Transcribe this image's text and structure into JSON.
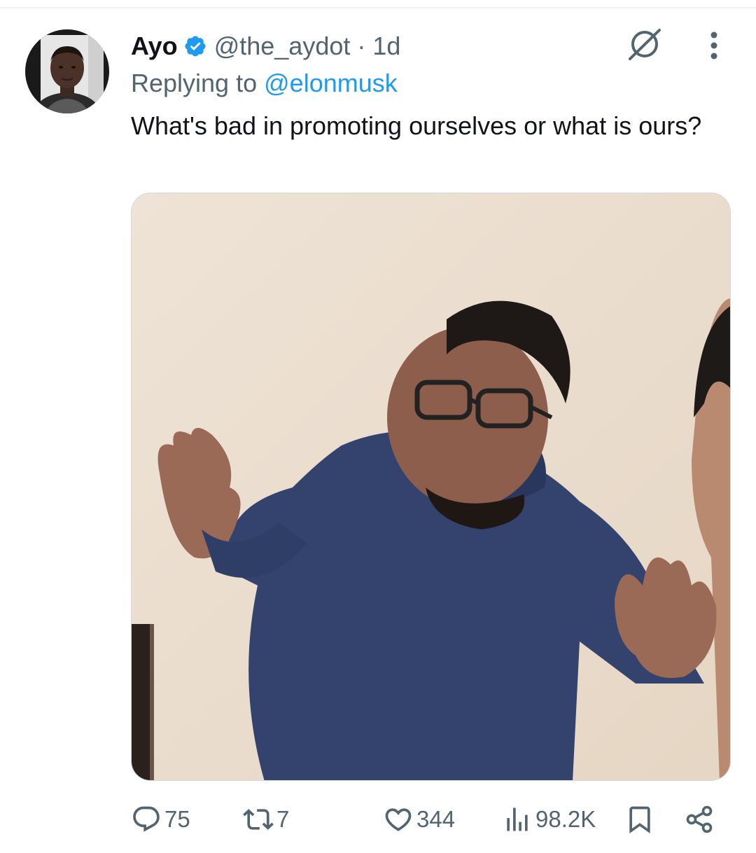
{
  "tweet": {
    "display_name": "Ayo",
    "verified": true,
    "handle": "@the_aydot",
    "separator": "·",
    "time": "1d",
    "reply_prefix": "Replying to",
    "reply_to": "@elonmusk",
    "text": "What's bad in promoting ourselves or what is ours?",
    "media_alt": "Man in blue sweater and glasses raising both hands"
  },
  "actions": {
    "replies": "75",
    "reposts": "7",
    "likes": "344",
    "views": "98.2K"
  },
  "icons": {
    "header": [
      "grok-icon",
      "more-icon"
    ],
    "actions": [
      "reply-icon",
      "repost-icon",
      "like-icon",
      "views-icon",
      "bookmark-icon",
      "share-icon"
    ]
  },
  "colors": {
    "accent": "#1d9bf0",
    "secondary_text": "#536471",
    "primary_text": "#0f1419"
  }
}
